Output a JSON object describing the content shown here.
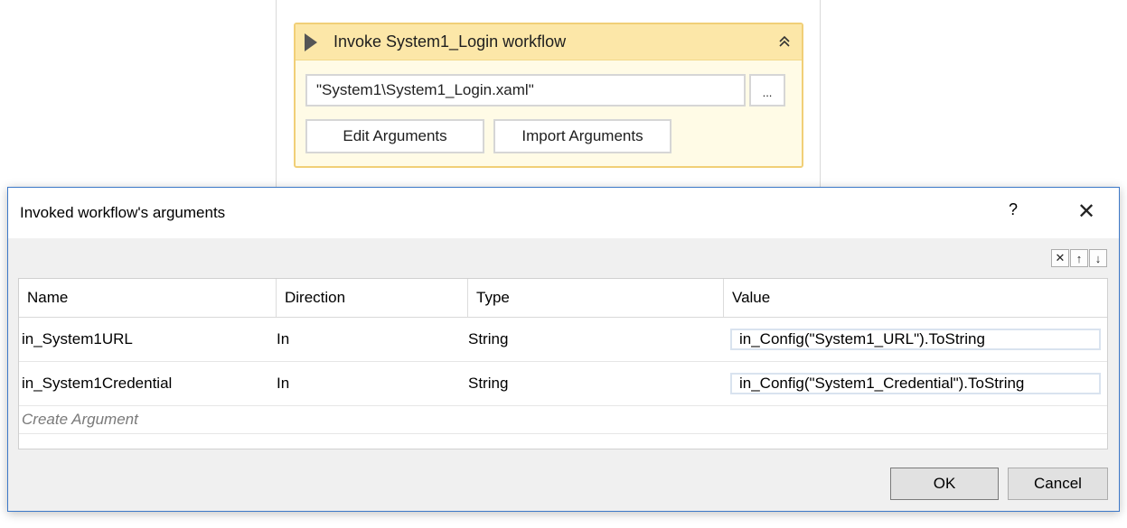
{
  "activity": {
    "title": "Invoke System1_Login workflow",
    "collapse_icon": "double-chevron-up-icon",
    "workflow_path": "\"System1\\System1_Login.xaml\"",
    "browse_label": "...",
    "edit_arguments_label": "Edit Arguments",
    "import_arguments_label": "Import Arguments"
  },
  "dialog": {
    "title": "Invoked workflow's arguments",
    "help_label": "?",
    "close_label": "✕",
    "tools": {
      "delete_label": "✕",
      "move_up_label": "↑",
      "move_down_label": "↓"
    },
    "grid": {
      "headers": [
        "Name",
        "Direction",
        "Type",
        "Value"
      ],
      "rows": [
        {
          "name": "in_System1URL",
          "direction": "In",
          "type": "String",
          "value": "in_Config(\"System1_URL\").ToString"
        },
        {
          "name": "in_System1Credential",
          "direction": "In",
          "type": "String",
          "value": "in_Config(\"System1_Credential\").ToString"
        }
      ],
      "create_label": "Create Argument"
    },
    "ok_label": "OK",
    "cancel_label": "Cancel"
  }
}
